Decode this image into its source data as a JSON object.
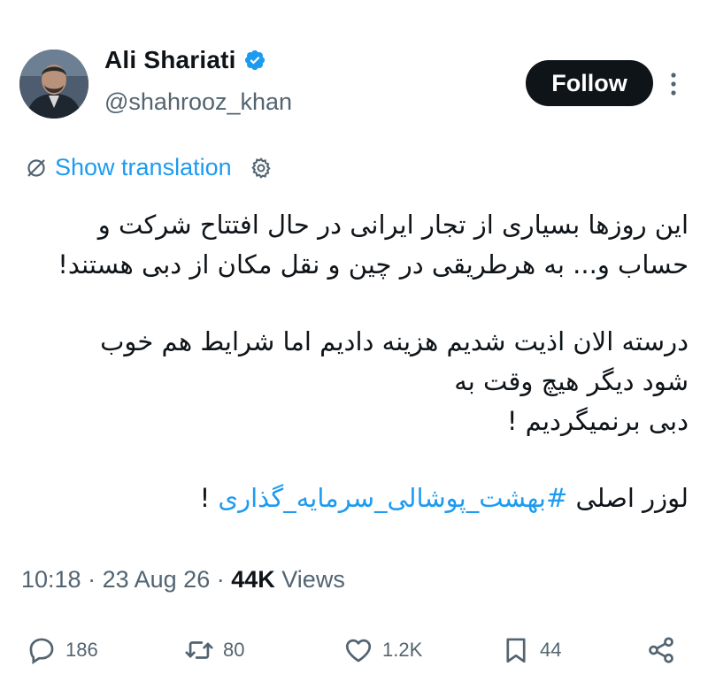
{
  "author": {
    "display_name": "Ali Shariati",
    "handle": "@shahrooz_khan",
    "verified": true
  },
  "follow_label": "Follow",
  "translation_label": "Show translation",
  "tweet": {
    "lines": [
      "این روزها بسیاری از تجار ایرانی در حال افتتاح شرکت و",
      "حساب و... به هرطریقی در چین و نقل مکان از دبی هستند!",
      "درسته الان اذیت شدیم هزینه دادیم  اما شرایط هم خوب",
      "شود دیگر هیچ وقت به",
      "دبی برنمیگردیم !"
    ],
    "last_line_prefix": "لوزر اصلی ",
    "hashtag": "#بهشت_پوشالی_سرمایه_گذاری",
    "last_line_suffix": " !"
  },
  "meta": {
    "time": "10:18",
    "date": "23 Aug 26",
    "views_count": "44K",
    "views_label": "Views"
  },
  "actions": {
    "replies": "186",
    "reposts": "80",
    "likes": "1.2K",
    "bookmarks": "44"
  },
  "colors": {
    "accent": "#1d9bf0",
    "text": "#0f1419",
    "muted": "#536471"
  },
  "icons": [
    "verified-badge-icon",
    "more-icon",
    "globe-slash-icon",
    "gear-icon",
    "reply-icon",
    "repost-icon",
    "like-icon",
    "bookmark-icon",
    "share-icon"
  ]
}
